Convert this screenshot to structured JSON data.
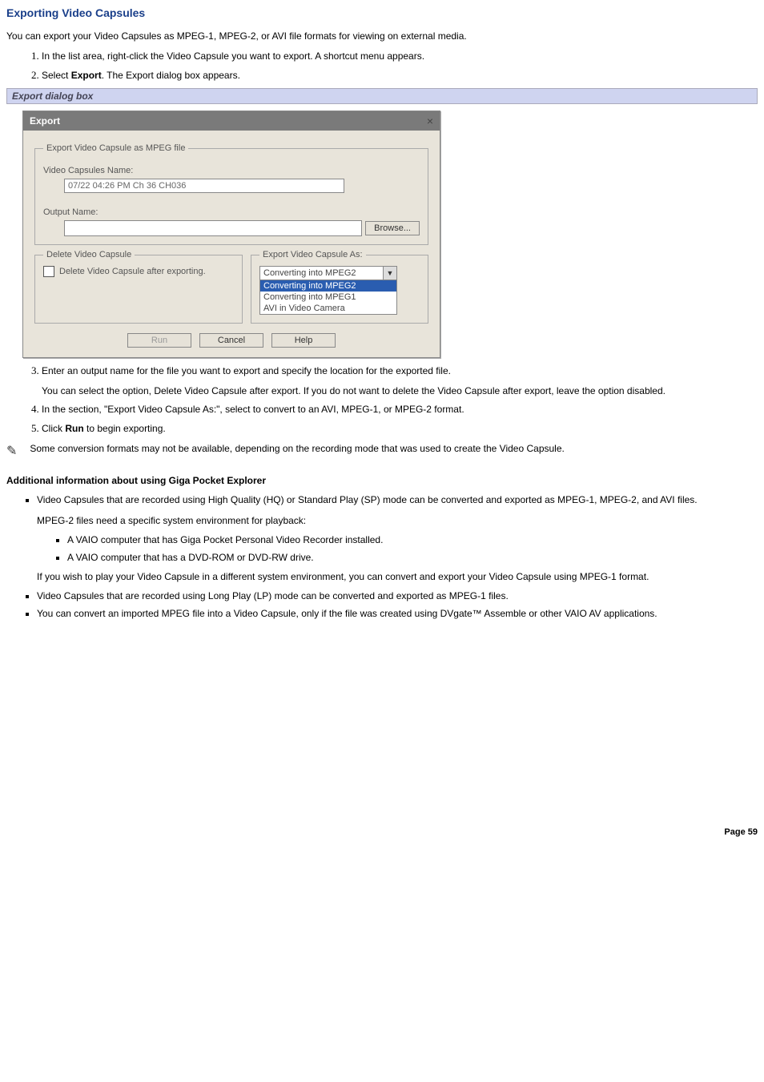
{
  "title": "Exporting Video Capsules",
  "intro": "You can export your Video Capsules as MPEG-1, MPEG-2, or AVI file formats for viewing on external media.",
  "steps_a": [
    "In the list area, right-click the Video Capsule you want to export. A shortcut menu appears.",
    "Select <b>Export</b>. The Export dialog box appears."
  ],
  "caption": "Export dialog box",
  "dialog": {
    "title": "Export",
    "close": "×",
    "group1": {
      "legend": "Export Video Capsule as MPEG file",
      "name_label": "Video Capsules Name:",
      "name_value": "07/22 04:26 PM Ch 36 CH036",
      "output_label": "Output Name:",
      "browse": "Browse..."
    },
    "delete_group": {
      "legend": "Delete Video Capsule",
      "check_label": "Delete Video Capsule after exporting."
    },
    "export_as": {
      "legend": "Export Video Capsule As:",
      "selected": "Converting into MPEG2",
      "options": [
        "Converting into MPEG2",
        "Converting into MPEG1",
        "AVI in Video Camera"
      ]
    },
    "buttons": {
      "run": "Run",
      "cancel": "Cancel",
      "help": "Help"
    }
  },
  "steps_b": {
    "s3": "Enter an output name for the file you want to export and specify the location for the exported file.",
    "s3_sub": "You can select the option, Delete Video Capsule after export. If you do not want to delete the Video Capsule after export, leave the option disabled.",
    "s4": "In the section, \"Export Video Capsule As:\", select to convert to an AVI, MPEG-1, or MPEG-2 format.",
    "s5": "Click <b>Run</b> to begin exporting."
  },
  "note": " Some conversion formats may not be available, depending on the recording mode that was used to create the Video Capsule.",
  "addl_head": "Additional information about using Giga Pocket Explorer",
  "addl": {
    "b1": "Video Capsules that are recorded using High Quality (HQ) or Standard Play (SP) mode can be converted and exported as MPEG-1, MPEG-2, and AVI files.",
    "b1_sub": "MPEG-2 files need a specific system environment for playback:",
    "b1_n1": "A VAIO computer that has Giga Pocket Personal Video Recorder installed.",
    "b1_n2": "A VAIO computer that has a DVD-ROM or DVD-RW drive.",
    "b1_tail": "If you wish to play your Video Capsule in a different system environment, you can convert and export your Video Capsule using MPEG-1 format.",
    "b2": "Video Capsules that are recorded using Long Play (LP) mode can be converted and exported as MPEG-1 files.",
    "b3": "You can convert an imported MPEG file into a Video Capsule, only if the file was created using DVgate™ Assemble or other VAIO AV applications."
  },
  "page": "Page 59"
}
